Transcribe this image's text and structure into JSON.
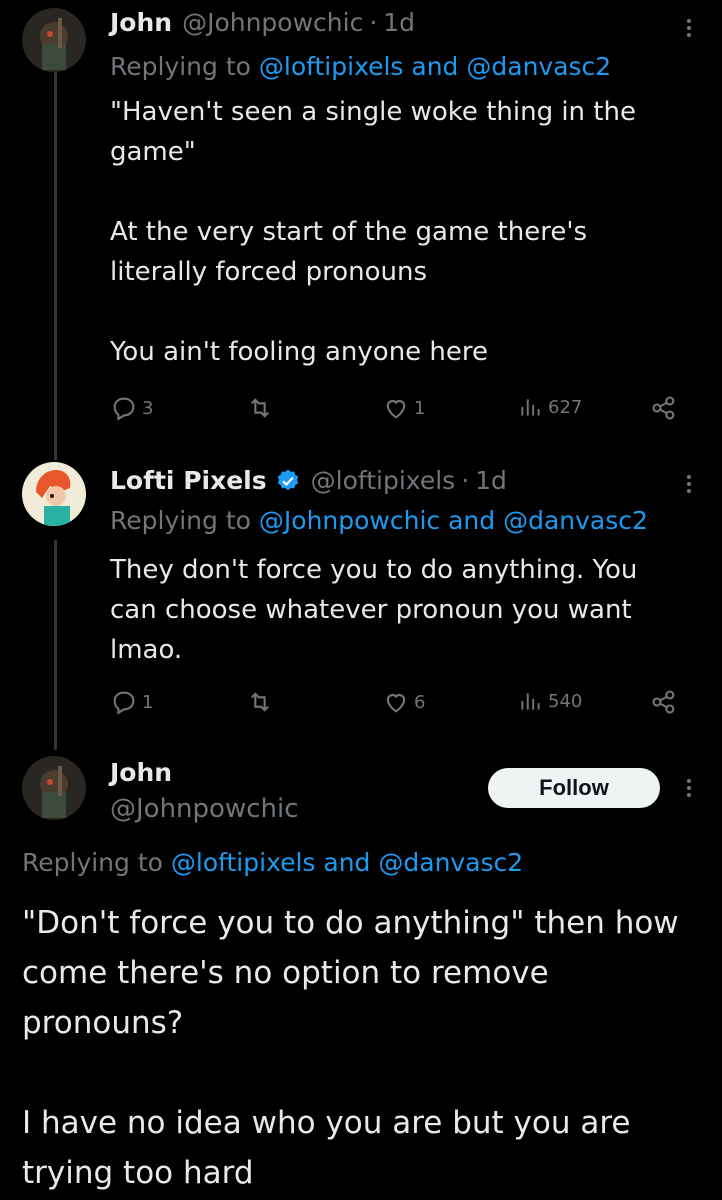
{
  "tweets": [
    {
      "display_name": "John",
      "handle": "@Johnpowchic",
      "time": "1d",
      "replying_prefix": "Replying to",
      "replying_to": "@loftipixels and @danvasc2",
      "body": "\"Haven't seen a single woke thing in the game\"\n\nAt the very start of the game there's literally forced pronouns\n\nYou ain't fooling anyone here",
      "replies": "3",
      "reposts": "",
      "likes": "1",
      "views": "627"
    },
    {
      "display_name": "Lofti Pixels",
      "handle": "@loftipixels",
      "time": "1d",
      "replying_prefix": "Replying to",
      "replying_to": "@Johnpowchic and @danvasc2",
      "body": "They don't force you to do anything. You can choose whatever pronoun you want lmao.",
      "replies": "1",
      "reposts": "",
      "likes": "6",
      "views": "540"
    }
  ],
  "main_tweet": {
    "display_name": "John",
    "handle": "@Johnpowchic",
    "follow_label": "Follow",
    "replying_prefix": "Replying to",
    "replying_to": "@loftipixels and @danvasc2",
    "body": "\"Don't force you to do anything\" then how come there's no option to remove pronouns?\n\nI have no idea who you are but you are trying too hard"
  },
  "icons": [
    "reply-icon",
    "repost-icon",
    "like-icon",
    "views-icon",
    "share-icon",
    "more-icon",
    "verified-badge-icon"
  ],
  "colors": {
    "background": "#000000",
    "text": "#e7e9ea",
    "muted": "#71767b",
    "link": "#1d9bf0",
    "verified": "#1d9bf0",
    "follow_bg": "#eff3f4"
  }
}
